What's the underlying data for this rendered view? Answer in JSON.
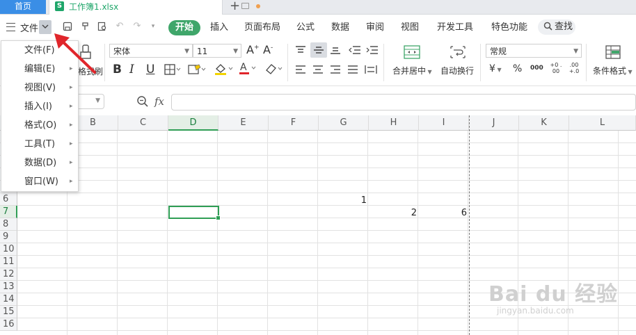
{
  "tabbar": {
    "home_tab": "首页",
    "file_tab": "工作簿1.xlsx",
    "new_tab": "+"
  },
  "menubar": {
    "file_menu": "文件",
    "ribbon_tabs": [
      "开始",
      "插入",
      "页面布局",
      "公式",
      "数据",
      "审阅",
      "视图",
      "开发工具",
      "特色功能"
    ],
    "search_label": "查找"
  },
  "ribbon": {
    "font_name": "宋体",
    "font_size": "11",
    "format_painter_label": "格式刷",
    "merge_label": "合并居中",
    "wrap_label": "自动换行",
    "number_format": "常规",
    "conditional_format_label": "条件格式",
    "bold": "B",
    "italic": "I",
    "underline": "U",
    "currency": "¥",
    "percent": "%",
    "thousands": "000",
    "inc_decimal": "+0 .00",
    "dec_decimal": ".00 +.0"
  },
  "formula_bar": {
    "fx_label": "fx",
    "value": ""
  },
  "dropdown_menu": {
    "items": [
      {
        "label": "文件(F)",
        "has_submenu": false
      },
      {
        "label": "编辑(E)",
        "has_submenu": true
      },
      {
        "label": "视图(V)",
        "has_submenu": true
      },
      {
        "label": "插入(I)",
        "has_submenu": true
      },
      {
        "label": "格式(O)",
        "has_submenu": true
      },
      {
        "label": "工具(T)",
        "has_submenu": true
      },
      {
        "label": "数据(D)",
        "has_submenu": true
      },
      {
        "label": "窗口(W)",
        "has_submenu": true
      }
    ]
  },
  "sheet": {
    "columns": [
      "B",
      "C",
      "D",
      "E",
      "F",
      "G",
      "H",
      "I",
      "J",
      "K",
      "L"
    ],
    "active_column": "D",
    "rows": [
      "6",
      "7",
      "8",
      "9",
      "10",
      "11",
      "12",
      "13",
      "14",
      "15",
      "16"
    ],
    "active_row": "7",
    "selected_cell": "D7",
    "cells": [
      {
        "ref": "G6",
        "value": "1"
      },
      {
        "ref": "H7",
        "value": "2"
      },
      {
        "ref": "I7",
        "value": "6"
      }
    ]
  },
  "watermark": {
    "brand": "Bai du 经验",
    "url": "jingyan.baidu.com"
  },
  "colors": {
    "accent_green": "#3fa66a",
    "selection_green": "#2f9e55",
    "home_tab_blue": "#3a8ee6",
    "arrow_red": "#e0262b"
  }
}
